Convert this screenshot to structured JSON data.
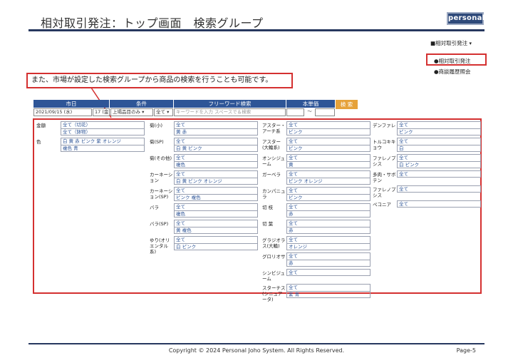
{
  "header": {
    "title": "相対取引発注：トップ画面　検索グループ",
    "logo_text": "personal"
  },
  "side_menu": {
    "dropdown_label": "■相対取引発注",
    "dropdown_caret": "▾",
    "items": [
      "●相対取引発注",
      "●商談履歴照会"
    ]
  },
  "callout": {
    "text": "また、市場が設定した検索グループから商品の検索を行うことも可能です。"
  },
  "search_bar": {
    "headers": {
      "date": "市日",
      "condition": "条件",
      "freeword": "フリーワード検索",
      "unit_price": "本単価"
    },
    "date_value": "2021/09/15 (水)",
    "date_tail": "17 (金",
    "condition_value": "上場品目のみ ▾",
    "condition2_value": "全て ▾",
    "freeword_placeholder": "キーワードを入力 スペースで＆検索",
    "price_separator": "〜",
    "search_button": "検 索"
  },
  "groups": [
    {
      "rows": [
        {
          "label": "金額",
          "values": [
            "全て（切花）",
            "全て（鉢物）"
          ]
        },
        {
          "label": "色",
          "values": [
            "白 黄 赤 ピンク 紫 オレンジ",
            "複色 青"
          ]
        }
      ]
    },
    {
      "rows": [
        {
          "label": "菊(小)",
          "values": [
            "全て",
            "黄 赤"
          ]
        },
        {
          "label": "菊(SP)",
          "values": [
            "全て",
            "白 黄 ピンク"
          ]
        },
        {
          "label": "菊(その他)",
          "values": [
            "全て",
            "複色"
          ]
        },
        {
          "label": "カーネーション",
          "values": [
            "全て",
            "白 黄 ピンク オレンジ"
          ]
        },
        {
          "label": "カーネーション(SP)",
          "values": [
            "全て",
            "ピンク 複色"
          ]
        },
        {
          "label": "バラ",
          "values": [
            "全て",
            "複色"
          ]
        },
        {
          "label": "バラ(SP)",
          "values": [
            "全て",
            "黄 複色"
          ]
        },
        {
          "label": "ゆり(オリエンタル系)",
          "values": [
            "全て",
            "白 ピンク"
          ]
        }
      ]
    },
    {
      "rows": [
        {
          "label": "アスター・アーチ系",
          "values": [
            "全て",
            "ピンク"
          ]
        },
        {
          "label": "アスター(大輪系)",
          "values": [
            "全て",
            "ピンク"
          ]
        },
        {
          "label": "オンシジューム",
          "values": [
            "全て",
            "黄"
          ]
        },
        {
          "label": "ガーベラ",
          "values": [
            "全て",
            "ピンク オレンジ"
          ]
        },
        {
          "label": "カンパニュラ",
          "values": [
            "全て",
            "ピンク"
          ]
        },
        {
          "label": "切 枝",
          "values": [
            "全て",
            "赤"
          ]
        },
        {
          "label": "切 葉",
          "values": [
            "全て",
            "赤"
          ]
        },
        {
          "label": "グラジオラス(大輪)",
          "values": [
            "全て",
            "オレンジ"
          ]
        },
        {
          "label": "グロリオサ",
          "values": [
            "全て",
            "赤"
          ]
        },
        {
          "label": "シンビジューム",
          "values": [
            "全て"
          ]
        },
        {
          "label": "スターチス(シニュアータ)",
          "values": [
            "全て",
            "紫 青"
          ]
        }
      ]
    },
    {
      "rows": [
        {
          "label": "デンファレ",
          "values": [
            "全て",
            "ピンク"
          ]
        },
        {
          "label": "トルコキキョウ",
          "values": [
            "全て",
            "白"
          ]
        },
        {
          "label": "ファレノプシス",
          "values": [
            "全て",
            "白 ピンク"
          ]
        },
        {
          "label": "多肉・サボテン",
          "values": [
            "全て"
          ]
        },
        {
          "label": "ファレノプシス",
          "values": [
            "全て"
          ]
        },
        {
          "label": "ペコニア",
          "values": [
            "全て"
          ]
        }
      ]
    }
  ],
  "footer": {
    "copyright": "Copyright © 2024 Personal Joho System. All Rights Reserved.",
    "page": "Page-5"
  },
  "colors": {
    "navy": "#27385f",
    "header_blue": "#2e5597",
    "highlight_red": "#d43030",
    "search_orange": "#e6a23a"
  }
}
